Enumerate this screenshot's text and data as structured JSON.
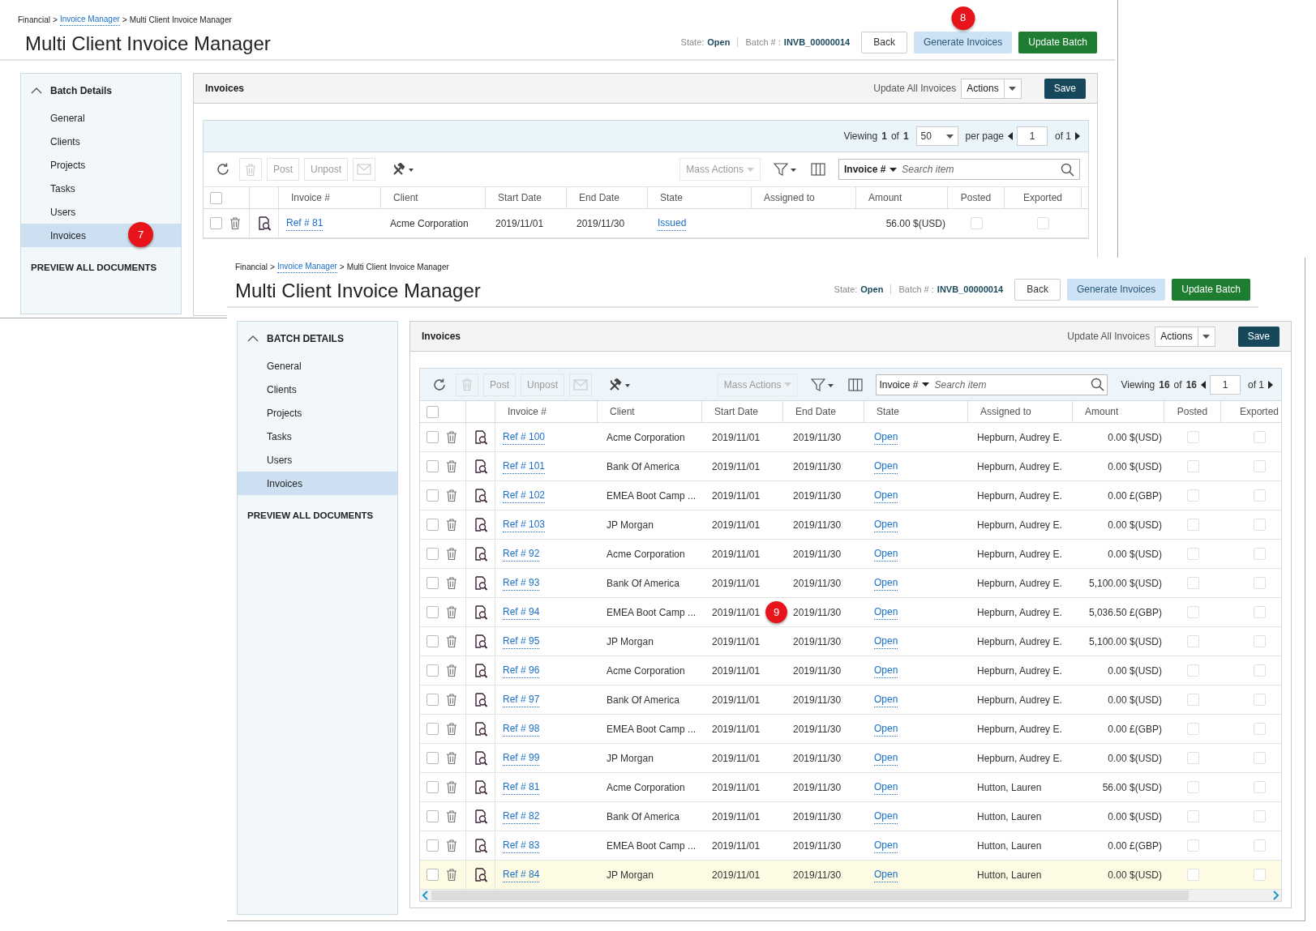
{
  "screens": [
    {
      "breadcrumb": [
        {
          "text": "Financial",
          "link": false,
          "separator": ">"
        },
        {
          "text": "Invoice Manager",
          "link": true,
          "separator": ">"
        },
        {
          "text": "Multi Client Invoice Manager",
          "link": false
        }
      ],
      "title": "Multi Client Invoice Manager",
      "state_label": "State:",
      "state": "Open",
      "batch_label": "Batch # :",
      "batch": "INVB_00000014",
      "buttons": [
        {
          "label": "Back",
          "kind": "default"
        },
        {
          "label": "Generate Invoices",
          "kind": "light",
          "callout": "8"
        },
        {
          "label": "Update Batch",
          "kind": "primary"
        }
      ],
      "sidebar": {
        "section": {
          "label": "Batch Details",
          "expanded": true
        },
        "items": [
          {
            "label": "General",
            "selected": false
          },
          {
            "label": "Clients",
            "selected": false
          },
          {
            "label": "Projects",
            "selected": false
          },
          {
            "label": "Tasks",
            "selected": false
          },
          {
            "label": "Users",
            "selected": false
          },
          {
            "label": "Invoices",
            "selected": true,
            "callout": "7"
          }
        ],
        "footer": "PREVIEW ALL DOCUMENTS"
      },
      "panel": {
        "title": "Invoices",
        "update_all": "Update All Invoices",
        "actions": "Actions",
        "save": "Save"
      },
      "pager_bar": {
        "viewing_label": "Viewing",
        "count": "1",
        "of_label": "of",
        "total": "1",
        "per_page": "50",
        "per_page_label": "per page",
        "page": "1",
        "pages_label": "of 1"
      },
      "toolbar": [
        {
          "kind": "refresh",
          "disabled": false
        },
        {
          "kind": "delete",
          "disabled": true
        },
        {
          "kind": "text",
          "label": "Post",
          "disabled": true
        },
        {
          "kind": "text",
          "label": "Unpost",
          "disabled": true
        },
        {
          "kind": "email",
          "disabled": true
        },
        {
          "kind": "tools",
          "disabled": false
        }
      ],
      "mass_actions": {
        "label": "Mass Actions",
        "disabled": true
      },
      "search": {
        "field": "Invoice #",
        "placeholder": "Search item"
      },
      "select_all_checked": false,
      "columns": [
        "Invoice #",
        "Client",
        "Start Date",
        "End Date",
        "State",
        "Assigned to",
        "Amount",
        "Posted",
        "Exported"
      ],
      "rows": [
        {
          "ref": "Ref # 81",
          "client": "Acme Corporation",
          "start": "2019/11/01",
          "end": "2019/11/30",
          "state": "Issued",
          "amount": "56.00 $(USD)",
          "checked": false,
          "posted": false,
          "exported": false,
          "highlighted": false
        }
      ]
    },
    {
      "breadcrumb": [
        {
          "text": "Financial",
          "link": false,
          "separator": ">"
        },
        {
          "text": "Invoice Manager",
          "link": true,
          "separator": ">"
        },
        {
          "text": "Multi Client Invoice Manager",
          "link": false
        }
      ],
      "title": "Multi Client Invoice Manager",
      "state_label": "State:",
      "state": "Open",
      "batch_label": "Batch # :",
      "batch": "INVB_00000014",
      "buttons": [
        {
          "label": "Back",
          "kind": "default"
        },
        {
          "label": "Generate Invoices",
          "kind": "light"
        },
        {
          "label": "Update Batch",
          "kind": "primary"
        }
      ],
      "sidebar": {
        "section": {
          "label": "BATCH DETAILS",
          "expanded": true
        },
        "items": [
          {
            "label": "General",
            "selected": false
          },
          {
            "label": "Clients",
            "selected": false
          },
          {
            "label": "Projects",
            "selected": false
          },
          {
            "label": "Tasks",
            "selected": false
          },
          {
            "label": "Users",
            "selected": false
          },
          {
            "label": "Invoices",
            "selected": true
          }
        ],
        "footer": "PREVIEW ALL DOCUMENTS"
      },
      "panel": {
        "title": "Invoices",
        "update_all": "Update All Invoices",
        "actions": "Actions",
        "save": "Save"
      },
      "pager": {
        "viewing_label": "Viewing",
        "count": "16",
        "of_label": "of",
        "total": "16",
        "page": "1",
        "pages_label": "of 1"
      },
      "toolbar": [
        {
          "kind": "refresh",
          "disabled": false
        },
        {
          "kind": "delete",
          "disabled": true
        },
        {
          "kind": "text",
          "label": "Post",
          "disabled": true
        },
        {
          "kind": "text",
          "label": "Unpost",
          "disabled": true
        },
        {
          "kind": "email",
          "disabled": true
        },
        {
          "kind": "tools",
          "disabled": false
        }
      ],
      "mass_actions": {
        "label": "Mass Actions",
        "disabled": true
      },
      "search": {
        "field": "Invoice #",
        "placeholder": "Search item"
      },
      "select_all_checked": false,
      "columns": [
        "Invoice #",
        "Client",
        "Start Date",
        "End Date",
        "State",
        "Assigned to",
        "Amount",
        "Posted",
        "Exported"
      ],
      "rows": [
        {
          "ref": "Ref # 100",
          "client": "Acme Corporation",
          "start": "2019/11/01",
          "end": "2019/11/30",
          "state": "Open",
          "assigned": "Hepburn, Audrey E.",
          "amount": "0.00 $(USD)",
          "checked": false,
          "posted": false,
          "exported": false,
          "highlighted": false
        },
        {
          "ref": "Ref # 101",
          "client": "Bank Of America",
          "start": "2019/11/01",
          "end": "2019/11/30",
          "state": "Open",
          "assigned": "Hepburn, Audrey E.",
          "amount": "0.00 $(USD)",
          "checked": false,
          "posted": false,
          "exported": false,
          "highlighted": false
        },
        {
          "ref": "Ref # 102",
          "client": "EMEA Boot Camp ...",
          "start": "2019/11/01",
          "end": "2019/11/30",
          "state": "Open",
          "assigned": "Hepburn, Audrey E.",
          "amount": "0.00 £(GBP)",
          "checked": false,
          "posted": false,
          "exported": false,
          "highlighted": false
        },
        {
          "ref": "Ref # 103",
          "client": "JP Morgan",
          "start": "2019/11/01",
          "end": "2019/11/30",
          "state": "Open",
          "assigned": "Hepburn, Audrey E.",
          "amount": "0.00 $(USD)",
          "checked": false,
          "posted": false,
          "exported": false,
          "highlighted": false
        },
        {
          "ref": "Ref # 92",
          "client": "Acme Corporation",
          "start": "2019/11/01",
          "end": "2019/11/30",
          "state": "Open",
          "assigned": "Hepburn, Audrey E.",
          "amount": "0.00 $(USD)",
          "checked": false,
          "posted": false,
          "exported": false,
          "highlighted": false
        },
        {
          "ref": "Ref # 93",
          "client": "Bank Of America",
          "start": "2019/11/01",
          "end": "2019/11/30",
          "state": "Open",
          "assigned": "Hepburn, Audrey E.",
          "amount": "5,100.00 $(USD)",
          "checked": false,
          "posted": false,
          "exported": false,
          "highlighted": false
        },
        {
          "ref": "Ref # 94",
          "client": "EMEA Boot Camp ...",
          "start": "2019/11/01",
          "end": "2019/11/30",
          "state": "Open",
          "assigned": "Hepburn, Audrey E.",
          "amount": "5,036.50 £(GBP)",
          "checked": false,
          "posted": false,
          "exported": false,
          "highlighted": false,
          "callout": "9"
        },
        {
          "ref": "Ref # 95",
          "client": "JP Morgan",
          "start": "2019/11/01",
          "end": "2019/11/30",
          "state": "Open",
          "assigned": "Hepburn, Audrey E.",
          "amount": "5,100.00 $(USD)",
          "checked": false,
          "posted": false,
          "exported": false,
          "highlighted": false
        },
        {
          "ref": "Ref # 96",
          "client": "Acme Corporation",
          "start": "2019/11/01",
          "end": "2019/11/30",
          "state": "Open",
          "assigned": "Hepburn, Audrey E.",
          "amount": "0.00 $(USD)",
          "checked": false,
          "posted": false,
          "exported": false,
          "highlighted": false
        },
        {
          "ref": "Ref # 97",
          "client": "Bank Of America",
          "start": "2019/11/01",
          "end": "2019/11/30",
          "state": "Open",
          "assigned": "Hepburn, Audrey E.",
          "amount": "0.00 $(USD)",
          "checked": false,
          "posted": false,
          "exported": false,
          "highlighted": false
        },
        {
          "ref": "Ref # 98",
          "client": "EMEA Boot Camp ...",
          "start": "2019/11/01",
          "end": "2019/11/30",
          "state": "Open",
          "assigned": "Hepburn, Audrey E.",
          "amount": "0.00 £(GBP)",
          "checked": false,
          "posted": false,
          "exported": false,
          "highlighted": false
        },
        {
          "ref": "Ref # 99",
          "client": "JP Morgan",
          "start": "2019/11/01",
          "end": "2019/11/30",
          "state": "Open",
          "assigned": "Hepburn, Audrey E.",
          "amount": "0.00 $(USD)",
          "checked": false,
          "posted": false,
          "exported": false,
          "highlighted": false
        },
        {
          "ref": "Ref # 81",
          "client": "Acme Corporation",
          "start": "2019/11/01",
          "end": "2019/11/30",
          "state": "Open",
          "assigned": "Hutton, Lauren",
          "amount": "56.00 $(USD)",
          "checked": false,
          "posted": false,
          "exported": false,
          "highlighted": false
        },
        {
          "ref": "Ref # 82",
          "client": "Bank Of America",
          "start": "2019/11/01",
          "end": "2019/11/30",
          "state": "Open",
          "assigned": "Hutton, Lauren",
          "amount": "0.00 $(USD)",
          "checked": false,
          "posted": false,
          "exported": false,
          "highlighted": false
        },
        {
          "ref": "Ref # 83",
          "client": "EMEA Boot Camp ...",
          "start": "2019/11/01",
          "end": "2019/11/30",
          "state": "Open",
          "assigned": "Hutton, Lauren",
          "amount": "0.00 £(GBP)",
          "checked": false,
          "posted": false,
          "exported": false,
          "highlighted": false
        },
        {
          "ref": "Ref # 84",
          "client": "JP Morgan",
          "start": "2019/11/01",
          "end": "2019/11/30",
          "state": "Open",
          "assigned": "Hutton, Lauren",
          "amount": "0.00 $(USD)",
          "checked": false,
          "posted": false,
          "exported": false,
          "highlighted": true
        }
      ],
      "horizontal_scrollbar": true
    }
  ]
}
